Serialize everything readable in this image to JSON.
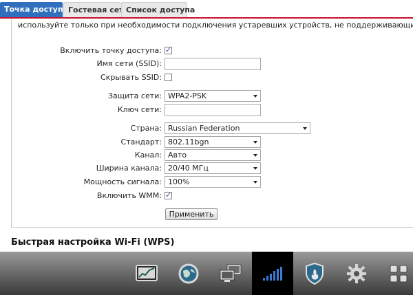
{
  "tabs": [
    {
      "label": "Точка доступа",
      "active": true
    },
    {
      "label": "Гостевая сеть",
      "active": false
    },
    {
      "label": "Список доступа",
      "active": false
    }
  ],
  "warning_text": "используйте только при необходимости подключения устаревших устройств, не поддерживающих WPA.",
  "form": {
    "enable_ap_label": "Включить точку доступа:",
    "enable_ap_checked": true,
    "ssid_label": "Имя сети (SSID):",
    "ssid_value": "",
    "hide_ssid_label": "Скрывать SSID:",
    "hide_ssid_checked": false,
    "security_label": "Защита сети:",
    "security_value": "WPA2-PSK",
    "key_label": "Ключ сети:",
    "key_value": "",
    "country_label": "Страна:",
    "country_value": "Russian Federation",
    "standard_label": "Стандарт:",
    "standard_value": "802.11bgn",
    "channel_label": "Канал:",
    "channel_value": "Авто",
    "width_label": "Ширина канала:",
    "width_value": "20/40 МГц",
    "power_label": "Мощность сигнала:",
    "power_value": "100%",
    "wmm_label": "Включить WMM:",
    "wmm_checked": true,
    "apply_label": "Применить"
  },
  "wps_heading": "Быстрая настройка Wi-Fi (WPS)",
  "bottom_nav": [
    {
      "icon": "monitor-chart-icon",
      "active": false
    },
    {
      "icon": "globe-icon",
      "active": false
    },
    {
      "icon": "network-computers-icon",
      "active": false
    },
    {
      "icon": "wifi-signal-icon",
      "active": true
    },
    {
      "icon": "shield-icon",
      "active": false
    },
    {
      "icon": "gear-icon",
      "active": false
    },
    {
      "icon": "apps-grid-icon",
      "active": false
    }
  ],
  "colors": {
    "tab_active": "#2f6fbd",
    "tab_underline": "#c8102e",
    "nav_active": "#000000"
  }
}
